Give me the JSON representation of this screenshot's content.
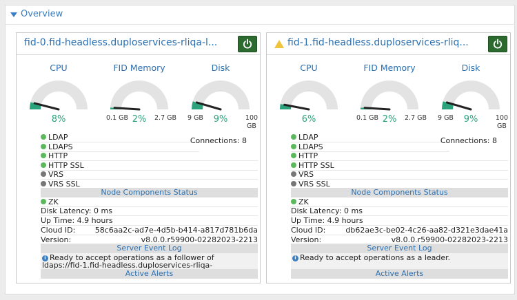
{
  "section": {
    "title": "Overview"
  },
  "nodes": [
    {
      "title": "fid-0.fid-headless.duploservices-rliqa-l...",
      "warning": false,
      "gauges": {
        "cpu": {
          "label": "CPU",
          "value_label": "8%",
          "min": "",
          "max": "",
          "fraction": 0.08
        },
        "memory": {
          "label": "FID Memory",
          "value_label": "2%",
          "min": "0.1 GB",
          "max": "2.7 GB",
          "fraction": 0.02
        },
        "disk": {
          "label": "Disk",
          "value_label": "9%",
          "min": "9 GB",
          "max": "100 GB",
          "fraction": 0.09
        }
      },
      "services": [
        {
          "label": "LDAP",
          "status": "green"
        },
        {
          "label": "LDAPS",
          "status": "green"
        },
        {
          "label": "HTTP",
          "status": "green"
        },
        {
          "label": "HTTP SSL",
          "status": "green"
        },
        {
          "label": "VRS",
          "status": "gray"
        },
        {
          "label": "VRS SSL",
          "status": "gray"
        }
      ],
      "connections": "Connections: 8",
      "node_components_title": "Node Components Status",
      "zk": "ZK",
      "disk_latency": "Disk Latency: 0 ms",
      "up_time": "Up Time: 4.9 hours",
      "cloud_id_label": "Cloud ID:",
      "cloud_id": "58c6aa2c-ad7e-4d5b-b414-a817d781b6da",
      "version_label": "Version:",
      "version": "v8.0.0.r59900-02282023-2213",
      "event_log_title": "Server Event Log",
      "event_message": "Ready to accept operations as a follower of ldaps://fid-1.fid-headless.duploservices-rliqa-",
      "alerts_title": "Active Alerts"
    },
    {
      "title": "fid-1.fid-headless.duploservices-rliq...",
      "warning": true,
      "gauges": {
        "cpu": {
          "label": "CPU",
          "value_label": "6%",
          "min": "",
          "max": "",
          "fraction": 0.06
        },
        "memory": {
          "label": "FID Memory",
          "value_label": "2%",
          "min": "0.1 GB",
          "max": "2.7 GB",
          "fraction": 0.02
        },
        "disk": {
          "label": "Disk",
          "value_label": "9%",
          "min": "9 GB",
          "max": "100 GB",
          "fraction": 0.09
        }
      },
      "services": [
        {
          "label": "LDAP",
          "status": "green"
        },
        {
          "label": "LDAPS",
          "status": "green"
        },
        {
          "label": "HTTP",
          "status": "green"
        },
        {
          "label": "HTTP SSL",
          "status": "green"
        },
        {
          "label": "VRS",
          "status": "gray"
        },
        {
          "label": "VRS SSL",
          "status": "gray"
        }
      ],
      "connections": "Connections: 8",
      "node_components_title": "Node Components Status",
      "zk": "ZK",
      "disk_latency": "Disk Latency: 0 ms",
      "up_time": "Up Time: 4.9 hours",
      "cloud_id_label": "Cloud ID:",
      "cloud_id": "db62ae3c-be02-4c26-aa82-d321e3dae41a",
      "version_label": "Version:",
      "version": "v8.0.0.r59900-02282023-2213",
      "event_log_title": "Server Event Log",
      "event_message": "Ready to accept operations as a leader.",
      "alerts_title": "Active Alerts"
    }
  ],
  "colors": {
    "accent": "#3a7fc1",
    "gauge_fill": "#2aa37d",
    "gauge_track": "#e3e3e3",
    "power": "#2d6a2f",
    "warning": "#f0c33c"
  }
}
